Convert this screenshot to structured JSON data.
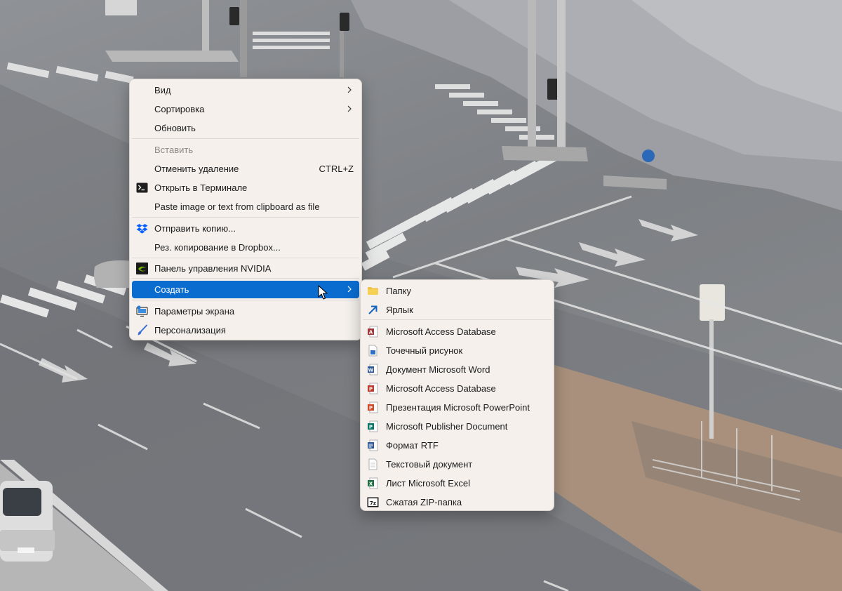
{
  "context_menu": {
    "items": [
      {
        "label": "Вид",
        "has_submenu": true
      },
      {
        "label": "Сортировка",
        "has_submenu": true
      },
      {
        "label": "Обновить"
      },
      {
        "label": "Вставить",
        "disabled": true
      },
      {
        "label": "Отменить удаление",
        "shortcut": "CTRL+Z"
      },
      {
        "label": "Открыть в Терминале",
        "icon": "terminal-icon"
      },
      {
        "label": "Paste image or text from clipboard as file"
      },
      {
        "label": "Отправить копию...",
        "icon": "dropbox-icon"
      },
      {
        "label": "Рез. копирование в Dropbox..."
      },
      {
        "label": "Панель управления NVIDIA",
        "icon": "nvidia-icon"
      },
      {
        "label": "Создать",
        "has_submenu": true,
        "highlighted": true
      },
      {
        "label": "Параметры экрана",
        "icon": "display-settings-icon"
      },
      {
        "label": "Персонализация",
        "icon": "brush-icon"
      }
    ]
  },
  "create_submenu": {
    "items": [
      {
        "label": "Папку",
        "icon": "folder-icon"
      },
      {
        "label": "Ярлык",
        "icon": "shortcut-arrow-icon"
      },
      {
        "label": "Microsoft Access Database",
        "icon": "access-icon"
      },
      {
        "label": "Точечный рисунок",
        "icon": "bitmap-icon"
      },
      {
        "label": "Документ Microsoft Word",
        "icon": "word-icon"
      },
      {
        "label": "Microsoft Access Database",
        "icon": "access-icon"
      },
      {
        "label": "Презентация Microsoft PowerPoint",
        "icon": "powerpoint-icon"
      },
      {
        "label": "Microsoft Publisher Document",
        "icon": "publisher-icon"
      },
      {
        "label": "Формат RTF",
        "icon": "rtf-icon"
      },
      {
        "label": "Текстовый документ",
        "icon": "text-document-icon"
      },
      {
        "label": "Лист Microsoft Excel",
        "icon": "excel-icon"
      },
      {
        "label": "Сжатая ZIP-папка",
        "icon": "zip-icon"
      }
    ]
  },
  "colors": {
    "menu_background": "#f5f0ec",
    "highlight": "#0a6ccf",
    "disabled_text": "#8c8986"
  }
}
